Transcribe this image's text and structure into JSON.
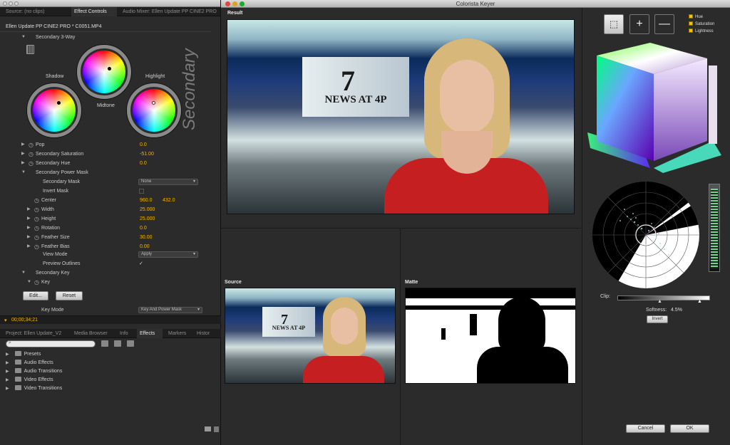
{
  "left_panel": {
    "tabs": [
      "Source: (no clips)",
      "Effect Controls",
      "Audio Mixer: Ellen Update PP CINE2 PRO"
    ],
    "clip_header": "Ellen Update PP CINE2 PRO * C0051.MP4",
    "section": "Secondary 3-Way",
    "vertical_title": "Secondary",
    "wheels": {
      "shadow": "Shadow",
      "midtone": "Midtone",
      "highlight": "Highlight"
    },
    "params": [
      {
        "label": "Pop",
        "value": "0.0"
      },
      {
        "label": "Secondary Saturation",
        "value": "-51.00"
      },
      {
        "label": "Secondary Hue",
        "value": "0.0"
      },
      {
        "label": "Secondary Power Mask"
      },
      {
        "label": "Secondary Mask",
        "value": "None"
      },
      {
        "label": "Invert Mask"
      },
      {
        "label": "Center",
        "value": "960.0",
        "value2": "432.0"
      },
      {
        "label": "Width",
        "value": "25.000"
      },
      {
        "label": "Height",
        "value": "25.000"
      },
      {
        "label": "Rotation",
        "value": "0.0"
      },
      {
        "label": "Feather Size",
        "value": "30.00"
      },
      {
        "label": "Feather Bias",
        "value": "0.00"
      },
      {
        "label": "View Mode",
        "value": "Apply"
      },
      {
        "label": "Preview Outlines",
        "value": "✓"
      },
      {
        "label": "Secondary Key"
      },
      {
        "label": "Key"
      },
      {
        "label": "Key Mode",
        "value": "Key And Power Mask"
      }
    ],
    "buttons": {
      "edit": "Edit...",
      "reset": "Reset"
    },
    "timecode": "00;00;34;21",
    "project_tabs": [
      "Project: Ellen Update_V2",
      "Media Browser",
      "Info",
      "Effects",
      "Markers",
      "Histor"
    ],
    "effects_folders": [
      "Presets",
      "Audio Effects",
      "Audio Transitions",
      "Video Effects",
      "Video Transitions"
    ]
  },
  "keyer": {
    "title": "Colorista Keyer",
    "result_label": "Result",
    "source_label": "Source",
    "matte_label": "Matte",
    "logo_text": "NEWS AT 4P",
    "logo_number": "7",
    "legend": [
      "Hue",
      "Saturation",
      "Lightness"
    ],
    "clip_label": "Clip:",
    "softness_label": "Softness:",
    "softness_value": "4.5%",
    "invert_label": "Invert",
    "cancel_label": "Cancel",
    "ok_label": "OK",
    "colors": {
      "accent": "#f2b400",
      "legend": "#f0c400"
    }
  }
}
